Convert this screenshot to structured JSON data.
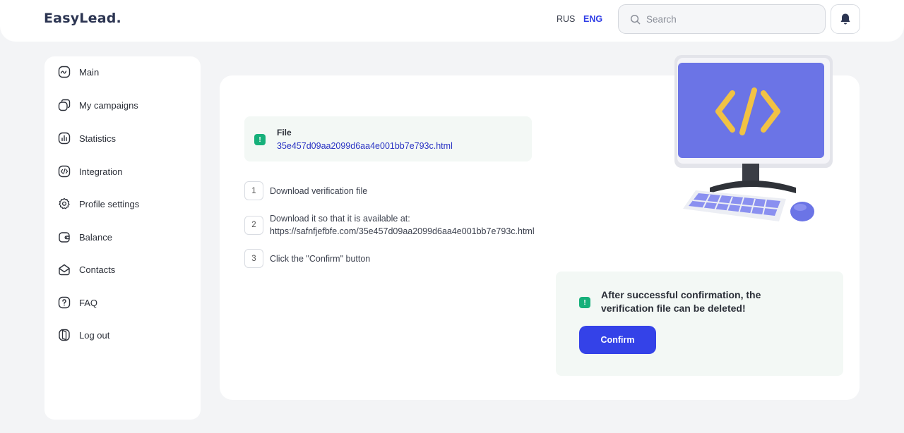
{
  "header": {
    "logo": "EasyLead.",
    "languages": [
      {
        "code": "RUS",
        "active": false
      },
      {
        "code": "ENG",
        "active": true
      }
    ],
    "search": {
      "placeholder": "Search",
      "value": ""
    },
    "accent_color": "#2f3de6"
  },
  "sidebar": {
    "items": [
      {
        "label": "Main",
        "icon": "chart-line-icon"
      },
      {
        "label": "My campaigns",
        "icon": "copy-icon"
      },
      {
        "label": "Statistics",
        "icon": "bar-chart-icon"
      },
      {
        "label": "Integration",
        "icon": "code-icon"
      },
      {
        "label": "Profile settings",
        "icon": "gear-icon"
      },
      {
        "label": "Balance",
        "icon": "wallet-icon"
      },
      {
        "label": "Contacts",
        "icon": "mail-icon"
      },
      {
        "label": "FAQ",
        "icon": "question-icon"
      },
      {
        "label": "Log out",
        "icon": "logout-icon"
      }
    ]
  },
  "main": {
    "file": {
      "badge": "!",
      "title": "File",
      "name": "35e457d09aa2099d6aa4e001bb7e793c.html"
    },
    "steps": [
      {
        "number": "1",
        "line1": "Download verification file",
        "line2": ""
      },
      {
        "number": "2",
        "line1": "Download it so that it is available at:",
        "line2": "https://safnfjefbfe.com/35e457d09aa2099d6aa4e001bb7e793c.html"
      },
      {
        "number": "3",
        "line1": "Click the \"Confirm\" button",
        "line2": ""
      }
    ],
    "confirm": {
      "badge": "!",
      "message": "After successful confirmation, the verification file can be deleted!",
      "button_label": "Confirm",
      "button_color": "#3442e8"
    },
    "illustration": "computer-code-illustration"
  }
}
